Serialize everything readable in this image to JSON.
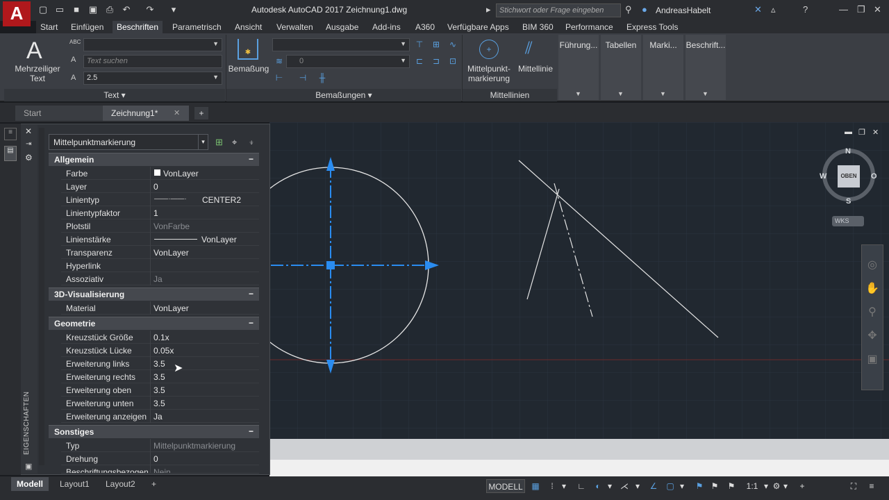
{
  "window": {
    "title": "Autodesk AutoCAD 2017   Zeichnung1.dwg",
    "search_placeholder": "Stichwort oder Frage eingeben",
    "user": "AndreasHabelt"
  },
  "menu_tabs": [
    "Start",
    "Einfügen",
    "Beschriften",
    "Parametrisch",
    "Ansicht",
    "Verwalten",
    "Ausgabe",
    "Add-ins",
    "A360",
    "Verfügbare Apps",
    "BIM 360",
    "Performance",
    "Express Tools"
  ],
  "ribbon": {
    "text_panel": {
      "big_button_line1": "Mehrzeiliger",
      "big_button_line2": "Text",
      "search_placeholder": "Text suchen",
      "height_value": "2.5",
      "label": "Text"
    },
    "dim_panel": {
      "big_button": "Bemaßung",
      "layer_value": "0",
      "label": "Bemaßungen"
    },
    "center_panel": {
      "btn1_line1": "Mittelpunkt-",
      "btn1_line2": "markierung",
      "btn2": "Mittellinie",
      "label": "Mittellinien"
    },
    "dropdowns": [
      "Führung...",
      "Tabellen",
      "Marki...",
      "Beschrift..."
    ]
  },
  "doc_tabs": {
    "start": "Start",
    "current": "Zeichnung1*"
  },
  "palette": {
    "selector": "Mittelpunktmarkierung",
    "side_label": "EIGENSCHAFTEN",
    "sections": {
      "allgemein": {
        "title": "Allgemein",
        "rows": [
          {
            "k": "Farbe",
            "v": "VonLayer"
          },
          {
            "k": "Layer",
            "v": "0"
          },
          {
            "k": "Linientyp",
            "v": "CENTER2"
          },
          {
            "k": "Linientypfaktor",
            "v": "1"
          },
          {
            "k": "Plotstil",
            "v": "VonFarbe"
          },
          {
            "k": "Linienstärke",
            "v": "VonLayer"
          },
          {
            "k": "Transparenz",
            "v": "VonLayer"
          },
          {
            "k": "Hyperlink",
            "v": ""
          },
          {
            "k": "Assoziativ",
            "v": "Ja"
          }
        ]
      },
      "vis3d": {
        "title": "3D-Visualisierung",
        "rows": [
          {
            "k": "Material",
            "v": "VonLayer"
          }
        ]
      },
      "geometrie": {
        "title": "Geometrie",
        "rows": [
          {
            "k": "Kreuzstück Größe",
            "v": "0.1x"
          },
          {
            "k": "Kreuzstück Lücke",
            "v": "0.05x"
          },
          {
            "k": "Erweiterung links",
            "v": "3.5"
          },
          {
            "k": "Erweiterung rechts",
            "v": "3.5"
          },
          {
            "k": "Erweiterung oben",
            "v": "3.5"
          },
          {
            "k": "Erweiterung unten",
            "v": "3.5"
          },
          {
            "k": "Erweiterung anzeigen",
            "v": "Ja"
          }
        ]
      },
      "sonstiges": {
        "title": "Sonstiges",
        "rows": [
          {
            "k": "Typ",
            "v": "Mittelpunktmarkierung"
          },
          {
            "k": "Drehung",
            "v": "0"
          },
          {
            "k": "Beschriftungsbezogen",
            "v": "Nein"
          }
        ]
      }
    }
  },
  "viewcube": {
    "n": "N",
    "s": "S",
    "w": "W",
    "o": "O",
    "face": "OBEN",
    "wks": "WKS"
  },
  "layout_tabs": [
    "Modell",
    "Layout1",
    "Layout2"
  ],
  "status": {
    "modell": "MODELL",
    "scale": "1:1"
  }
}
